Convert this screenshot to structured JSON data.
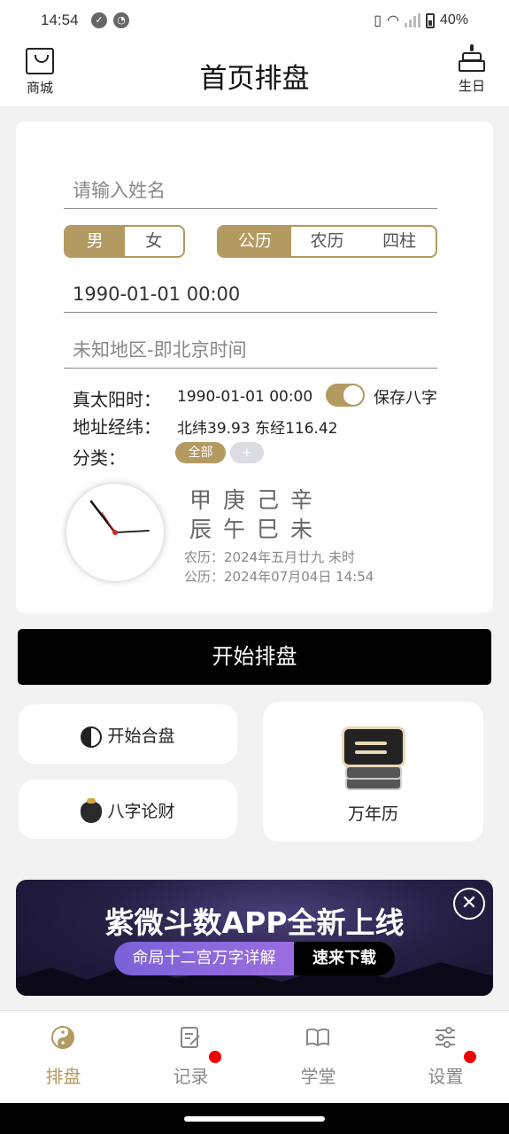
{
  "status_bar": {
    "time": "14:54",
    "battery": "40%"
  },
  "header": {
    "left_label": "商城",
    "title": "首页排盘",
    "right_label": "生日"
  },
  "form": {
    "name_placeholder": "请输入姓名",
    "gender_options": [
      "男",
      "女"
    ],
    "gender_selected": "男",
    "calendar_options": [
      "公历",
      "农历",
      "四柱"
    ],
    "calendar_selected": "公历",
    "datetime_value": "1990-01-01 00:00",
    "location_value": "未知地区-即北京时间",
    "solar_time_label": "真太阳时：",
    "solar_time_value": "1990-01-01 00:00",
    "save_bazi_label": "保存八字",
    "save_bazi_on": true,
    "coords_label": "地址经纬：",
    "coords_value": "北纬39.93 东经116.42",
    "category_label": "分类：",
    "category_all": "全部",
    "category_add": "+"
  },
  "bazi": {
    "stems": "甲庚己辛",
    "branches": "辰午巳未",
    "lunar_line": "农历：2024年五月廿九 未时",
    "solar_line": "公历：2024年07月04日 14:54"
  },
  "actions": {
    "start_label": "开始排盘",
    "hepan_label": "开始合盘",
    "lucai_label": "八字论财",
    "calendar_label": "万年历"
  },
  "banner": {
    "title": "紫微斗数APP全新上线",
    "pill_left": "命局十二宫万字详解",
    "pill_right": "速来下载",
    "close_symbol": "✕"
  },
  "bottom_nav": [
    {
      "label": "排盘",
      "icon": "yinyang-icon",
      "active": true
    },
    {
      "label": "记录",
      "icon": "notes-icon",
      "badge": true
    },
    {
      "label": "学堂",
      "icon": "book-icon"
    },
    {
      "label": "设置",
      "icon": "sliders-icon",
      "badge": true
    }
  ],
  "colors": {
    "accent": "#b29a60",
    "badge": "#e00000"
  }
}
